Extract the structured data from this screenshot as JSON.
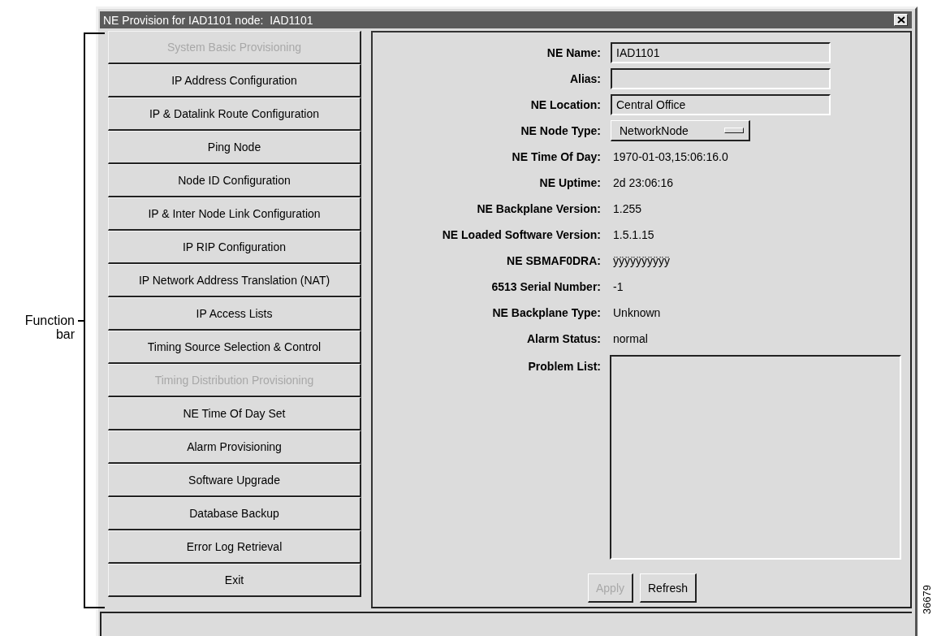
{
  "annotation": {
    "label": "Function bar"
  },
  "window": {
    "title": "NE Provision for IAD1101 node:  IAD1101"
  },
  "function_bar": [
    {
      "label": "System Basic Provisioning",
      "disabled": true
    },
    {
      "label": "IP Address Configuration",
      "disabled": false
    },
    {
      "label": "IP & Datalink Route Configuration",
      "disabled": false
    },
    {
      "label": "Ping Node",
      "disabled": false
    },
    {
      "label": "Node ID Configuration",
      "disabled": false
    },
    {
      "label": "IP & Inter Node Link Configuration",
      "disabled": false
    },
    {
      "label": "IP RIP Configuration",
      "disabled": false
    },
    {
      "label": "IP Network Address Translation (NAT)",
      "disabled": false
    },
    {
      "label": "IP Access Lists",
      "disabled": false
    },
    {
      "label": "Timing Source Selection & Control",
      "disabled": false
    },
    {
      "label": "Timing Distribution Provisioning",
      "disabled": true
    },
    {
      "label": "NE Time Of Day Set",
      "disabled": false
    },
    {
      "label": "Alarm Provisioning",
      "disabled": false
    },
    {
      "label": "Software Upgrade",
      "disabled": false
    },
    {
      "label": "Database Backup",
      "disabled": false
    },
    {
      "label": "Error Log Retrieval",
      "disabled": false
    },
    {
      "label": "Exit",
      "disabled": false
    }
  ],
  "fields": [
    {
      "kind": "input",
      "label": "NE Name:",
      "value": "IAD1101"
    },
    {
      "kind": "input",
      "label": "Alias:"
    },
    {
      "kind": "input",
      "label": "NE Location:",
      "value": "Central Office"
    },
    {
      "kind": "dropdown",
      "label": "NE Node Type:",
      "value": "NetworkNode"
    },
    {
      "kind": "text",
      "label": "NE Time Of Day:",
      "value": "1970-01-03,15:06:16.0"
    },
    {
      "kind": "text",
      "label": "NE Uptime:",
      "value": "2d 23:06:16"
    },
    {
      "kind": "text",
      "label": "NE Backplane Version:",
      "value": "1.255"
    },
    {
      "kind": "text",
      "label": "NE Loaded Software Version:",
      "value": "1.5.1.15"
    },
    {
      "kind": "text",
      "label": "NE SBMAF0DRA:",
      "value": "ÿÿÿÿÿÿÿÿÿÿ"
    },
    {
      "kind": "text",
      "label": "6513 Serial Number:",
      "value": "-1"
    },
    {
      "kind": "text",
      "label": "NE Backplane Type:",
      "value": "Unknown"
    },
    {
      "kind": "text",
      "label": "Alarm Status:",
      "value": "normal"
    },
    {
      "kind": "list",
      "label": "Problem List:"
    }
  ],
  "actions": [
    {
      "label": "Apply",
      "disabled": true
    },
    {
      "label": "Refresh",
      "disabled": false
    }
  ],
  "figure_number": "36679"
}
